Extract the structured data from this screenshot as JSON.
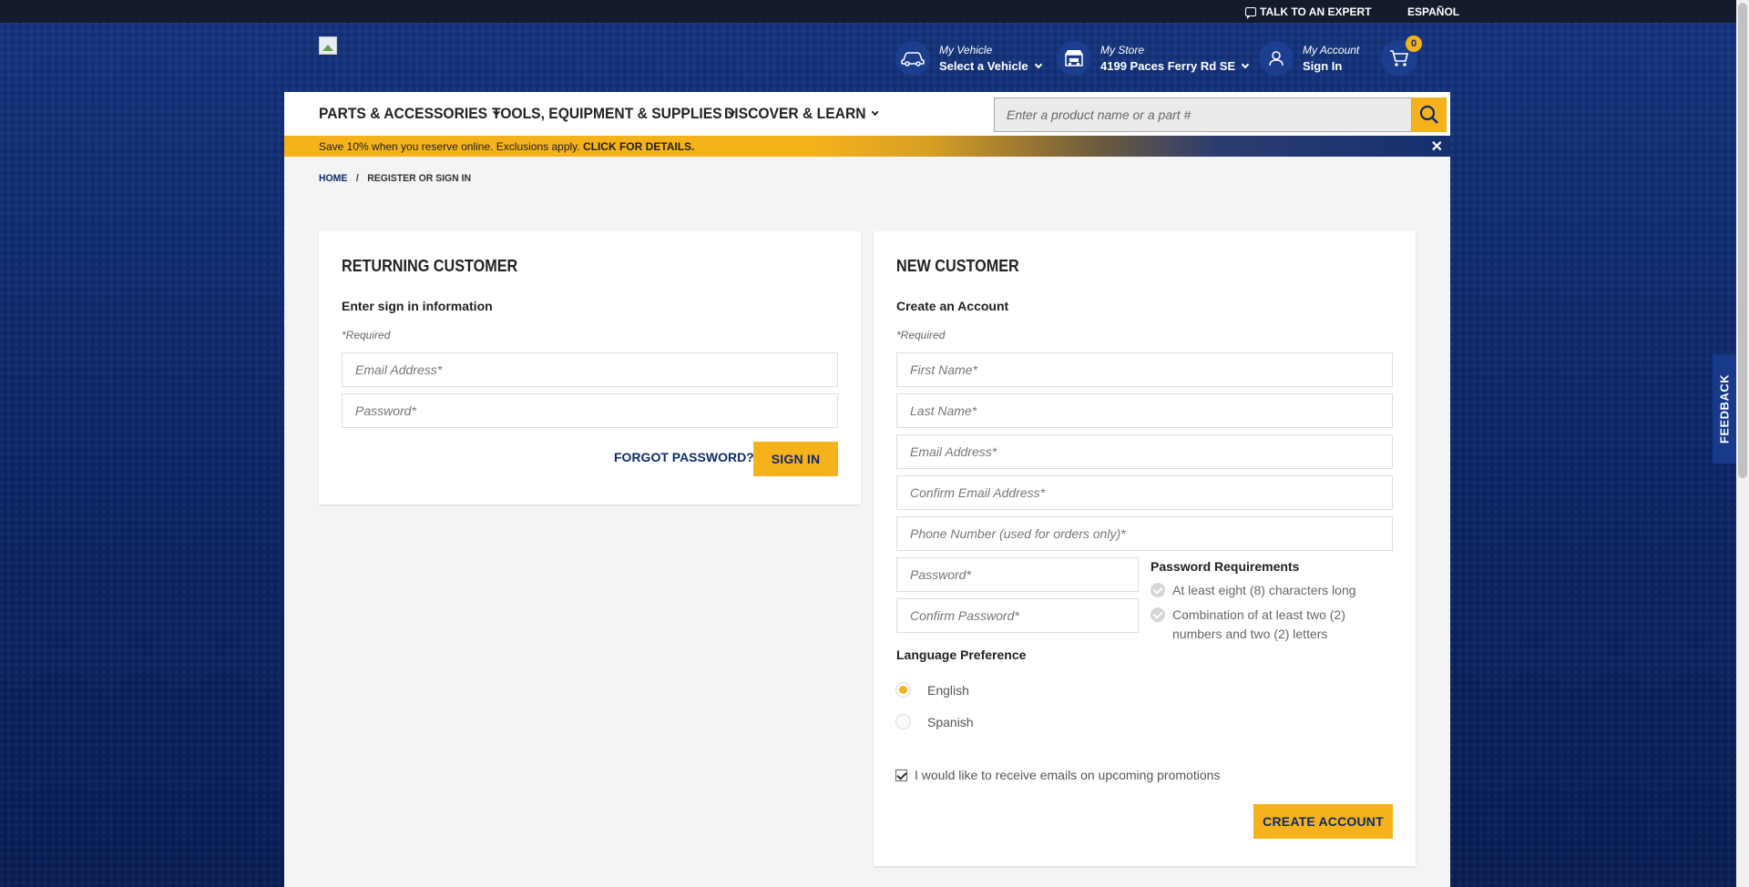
{
  "topbar": {
    "talk_label": "TALK TO AN EXPERT",
    "espanol_label": "ESPAÑOL"
  },
  "header": {
    "vehicle": {
      "label": "My Vehicle",
      "value": "Select a Vehicle"
    },
    "store": {
      "label": "My Store",
      "value": "4199 Paces Ferry Rd SE"
    },
    "account": {
      "label": "My Account",
      "value": "Sign In"
    },
    "cart_count": "0"
  },
  "nav": {
    "items": [
      {
        "label": "PARTS & ACCESSORIES"
      },
      {
        "label": "TOOLS, EQUIPMENT & SUPPLIES"
      },
      {
        "label": "DISCOVER & LEARN"
      }
    ],
    "search_placeholder": "Enter a product name or a part #"
  },
  "promo": {
    "text": "Save 10% when you reserve online. Exclusions apply. ",
    "link": "CLICK FOR DETAILS.",
    "close": "✕"
  },
  "breadcrumb": {
    "home": "HOME",
    "sep": "/",
    "current": "REGISTER OR SIGN IN"
  },
  "returning": {
    "title": "RETURNING CUSTOMER",
    "subtitle": "Enter sign in information",
    "required": "*Required",
    "email_placeholder": "Email Address*",
    "password_placeholder": "Password*",
    "forgot_label": "FORGOT PASSWORD?",
    "signin_label": "SIGN IN"
  },
  "new_customer": {
    "title": "NEW CUSTOMER",
    "subtitle": "Create an Account",
    "required": "*Required",
    "first_name_placeholder": "First Name*",
    "last_name_placeholder": "Last Name*",
    "email_placeholder": "Email Address*",
    "confirm_email_placeholder": "Confirm Email Address*",
    "phone_placeholder": "Phone Number (used for orders only)*",
    "password_placeholder": "Password*",
    "confirm_password_placeholder": "Confirm Password*",
    "pw_requirements": {
      "title": "Password Requirements",
      "items": [
        "At least eight (8) characters long",
        "Combination of at least two (2) numbers and two (2) letters"
      ]
    },
    "language": {
      "title": "Language Preference",
      "options": [
        "English",
        "Spanish"
      ],
      "selected": "English"
    },
    "promo_opt_in": "I would like to receive emails on upcoming promotions",
    "create_label": "CREATE ACCOUNT"
  },
  "feedback_label": "FEEDBACK",
  "colors": {
    "brand_blue": "#0d2a6b",
    "accent_yellow": "#f5b21b"
  }
}
